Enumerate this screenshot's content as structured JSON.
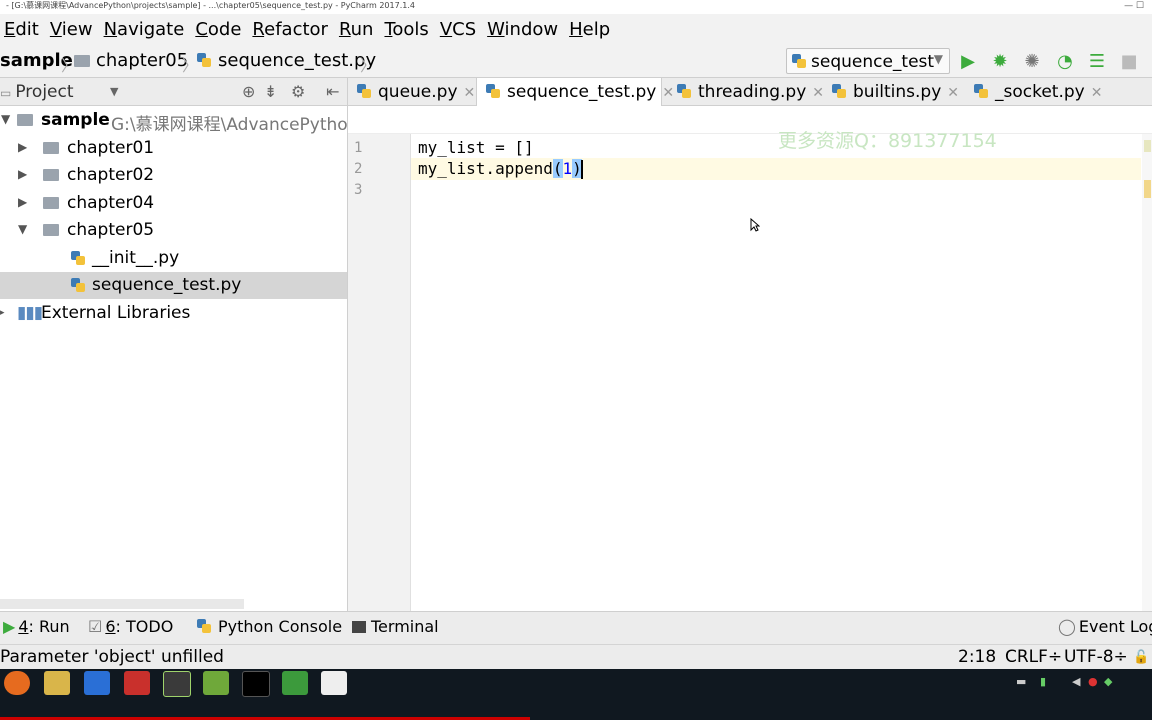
{
  "window": {
    "title": "- [G:\\慕课网课程\\AdvancePython\\projects\\sample] - ...\\chapter05\\sequence_test.py - PyCharm 2017.1.4"
  },
  "menu": [
    "Edit",
    "View",
    "Navigate",
    "Code",
    "Refactor",
    "Run",
    "Tools",
    "VCS",
    "Window",
    "Help"
  ],
  "breadcrumb": {
    "project": "sample",
    "folder": "chapter05",
    "file": "sequence_test.py"
  },
  "run_config": {
    "name": "sequence_test"
  },
  "project_panel": {
    "title": "Project",
    "root": {
      "name": "sample",
      "path": "G:\\慕课网课程\\AdvancePython"
    },
    "folders": [
      "chapter01",
      "chapter02",
      "chapter04",
      "chapter05"
    ],
    "files": [
      "__init__.py",
      "sequence_test.py"
    ],
    "external": "External Libraries"
  },
  "tabs": [
    "queue.py",
    "sequence_test.py",
    "threading.py",
    "builtins.py",
    "_socket.py"
  ],
  "active_tab": 1,
  "editor": {
    "line_numbers": [
      "1",
      "2",
      "3"
    ],
    "line1": "my_list = []",
    "line2_pre": "my_list.append",
    "line2_paren_open": "(",
    "line2_arg": "1",
    "line2_paren_close": ")",
    "watermark": "更多资源Q：891377154"
  },
  "tool_windows": {
    "run_num": "4",
    "run": ": Run",
    "todo_num": "6",
    "todo": ": TODO",
    "python_console": "Python Console",
    "terminal": "Terminal",
    "event_log": "Event Log"
  },
  "status_bar": {
    "message": "Parameter 'object' unfilled",
    "position": "2:18",
    "line_sep": "CRLF÷",
    "encoding": "UTF-8÷"
  },
  "colors": {
    "run_green": "#3dab3d",
    "accent_blue": "#3d7bb5"
  }
}
